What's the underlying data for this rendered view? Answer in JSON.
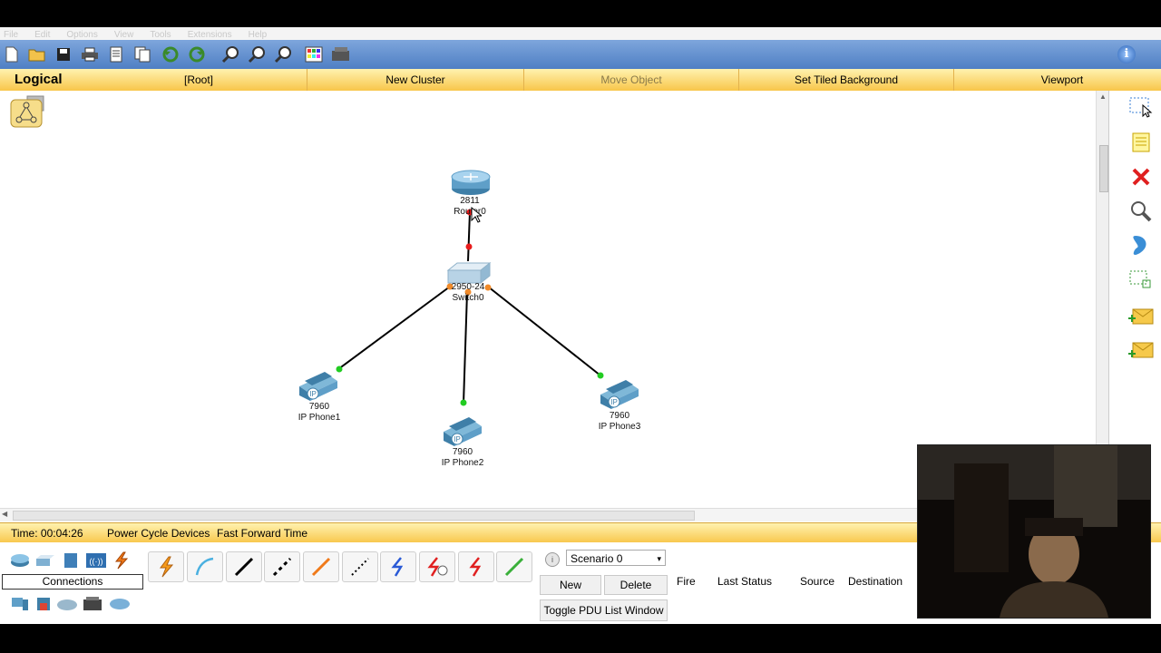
{
  "menu": [
    "File",
    "Edit",
    "Options",
    "View",
    "Tools",
    "Extensions",
    "Help"
  ],
  "toolbar_icons": [
    "new-icon",
    "open-icon",
    "save-icon",
    "print-icon",
    "activity-wizard-icon",
    "clipboard-icon",
    "copy-icon",
    "undo-icon",
    "redo-icon",
    "zoom-in-icon",
    "zoom-reset-icon",
    "zoom-out-icon",
    "palette-icon",
    "custom-device-icon",
    "info-icon"
  ],
  "workspace_bar": {
    "title": "Logical",
    "root": "[Root]",
    "new_cluster": "New Cluster",
    "move_object": "Move Object",
    "set_tiled_background": "Set Tiled Background",
    "viewport": "Viewport"
  },
  "devices": {
    "router": {
      "model": "2811",
      "name": "Router0"
    },
    "switch": {
      "model": "2950-24",
      "name": "Switch0"
    },
    "phone1": {
      "model": "7960",
      "name": "IP Phone1"
    },
    "phone2": {
      "model": "7960",
      "name": "IP Phone2"
    },
    "phone3": {
      "model": "7960",
      "name": "IP Phone3"
    },
    "phone_badge": "IP"
  },
  "right_palette": [
    "select-icon",
    "note-icon",
    "delete-icon",
    "inspect-icon",
    "draw-shape-icon",
    "resize-icon",
    "add-simple-pdu-icon",
    "add-complex-pdu-icon"
  ],
  "time_bar": {
    "time": "Time: 00:04:26",
    "power_cycle": "Power Cycle Devices",
    "fast_forward": "Fast Forward Time"
  },
  "device_panel": {
    "category_label": "Connections",
    "connection_type": "Copper Straight-Through"
  },
  "pdu_panel": {
    "scenario": "Scenario 0",
    "new": "New",
    "delete": "Delete",
    "toggle": "Toggle PDU List Window",
    "columns": [
      "Fire",
      "Last Status",
      "Source",
      "Destination"
    ]
  },
  "colors": {
    "toolbar": "#5b8bd0",
    "section_bar": "#f8c64a",
    "link": "#000000",
    "port_up": "#22cc22",
    "port_down": "#e81b1b",
    "port_orange": "#f08a2a"
  }
}
